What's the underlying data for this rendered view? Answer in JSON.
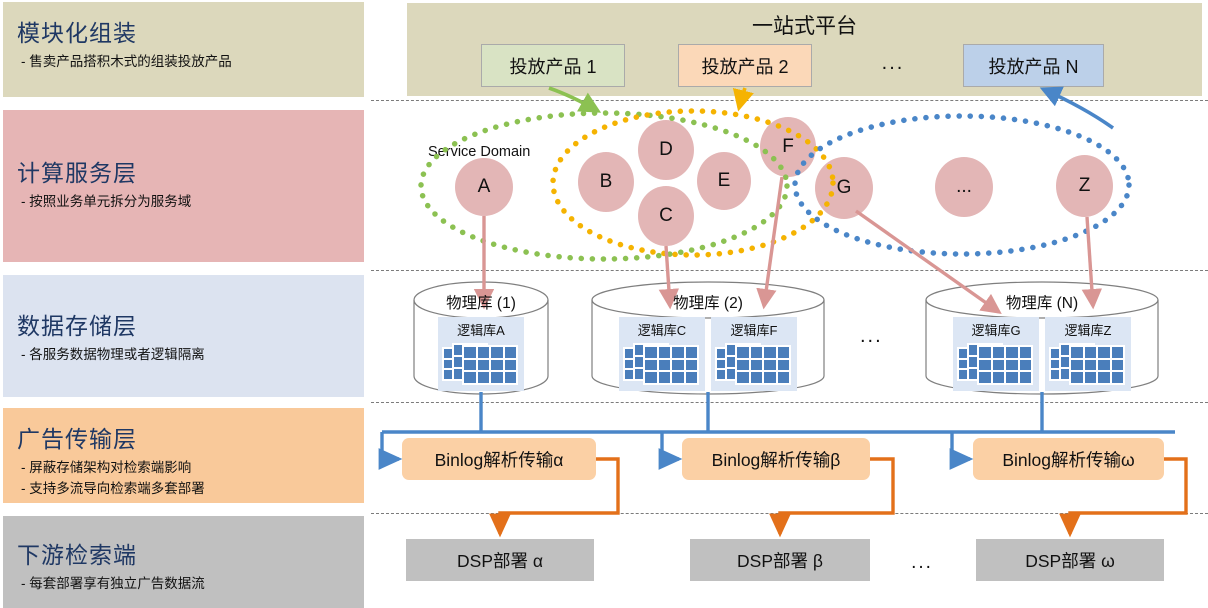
{
  "layers": [
    {
      "title": "模块化组装",
      "bullets": [
        "- 售卖产品搭积木式的组装投放产品"
      ]
    },
    {
      "title": "计算服务层",
      "bullets": [
        "- 按照业务单元拆分为服务域"
      ]
    },
    {
      "title": "数据存储层",
      "bullets": [
        "- 各服务数据物理或者逻辑隔离"
      ]
    },
    {
      "title": "广告传输层",
      "bullets": [
        "- 屏蔽存储架构对检索端影响",
        "- 支持多流导向检索端多套部署"
      ]
    },
    {
      "title": "下游检索端",
      "bullets": [
        "- 每套部署享有独立广告数据流"
      ]
    }
  ],
  "platform": {
    "title": "一站式平台",
    "products": [
      "投放产品 1",
      "投放产品 2",
      "投放产品 N"
    ],
    "ellipsis": "..."
  },
  "service_layer": {
    "domain_label": "Service Domain",
    "nodes": [
      "A",
      "B",
      "C",
      "D",
      "E",
      "F",
      "G",
      "...",
      "Z"
    ],
    "domains": [
      {
        "name": "green-domain",
        "color": "#8cc152"
      },
      {
        "name": "yellow-domain",
        "color": "#f5b301"
      },
      {
        "name": "blue-domain",
        "color": "#4a86c8"
      }
    ]
  },
  "storage_layer": {
    "databases": [
      {
        "title": "物理库 (1)",
        "logical": [
          "逻辑库A"
        ]
      },
      {
        "title": "物理库 (2)",
        "logical": [
          "逻辑库C",
          "逻辑库F"
        ]
      },
      {
        "title": "物理库 (N)",
        "logical": [
          "逻辑库G",
          "逻辑库Z"
        ]
      }
    ],
    "ellipsis": "..."
  },
  "transport_layer": {
    "boxes": [
      "Binlog解析传输α",
      "Binlog解析传输β",
      "Binlog解析传输ω"
    ]
  },
  "downstream_layer": {
    "boxes": [
      "DSP部署 α",
      "DSP部署 β",
      "DSP部署 ω"
    ],
    "ellipsis": "..."
  },
  "colors": {
    "panel_beige": "#dcd8bc",
    "panel_pink": "#e6b5b5",
    "panel_blue": "#dce3f0",
    "panel_orange": "#f9c99a",
    "panel_gray": "#c0c0c0",
    "title_text": "#1f3864",
    "node_fill": "#e3b6b6",
    "binlog_fill": "#fbd0a5",
    "arrow_blue": "#4a86c8",
    "arrow_orange": "#e3701a",
    "arrow_rose": "#d99694"
  }
}
